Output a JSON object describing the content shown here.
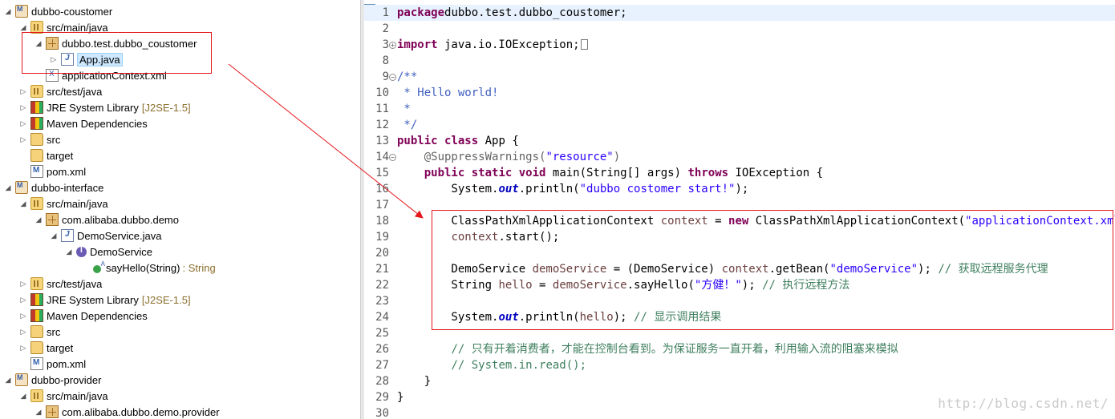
{
  "explorer": {
    "rows": [
      {
        "depth": 0,
        "twisty": "open",
        "icon": "maven-project-icon",
        "label": "dubbo-coustomer"
      },
      {
        "depth": 1,
        "twisty": "open",
        "icon": "source-folder-icon",
        "label": "src/main/java"
      },
      {
        "depth": 2,
        "twisty": "open",
        "icon": "package-icon",
        "label": "dubbo.test.dubbo_coustomer"
      },
      {
        "depth": 3,
        "twisty": "closed",
        "icon": "java-file-icon",
        "label": "App.java",
        "selected": true
      },
      {
        "depth": 2,
        "twisty": "none",
        "icon": "xml-file-icon",
        "label": "applicationContext.xml"
      },
      {
        "depth": 1,
        "twisty": "closed",
        "icon": "source-folder-icon",
        "label": "src/test/java"
      },
      {
        "depth": 1,
        "twisty": "closed",
        "icon": "library-icon",
        "label": "JRE System Library",
        "suffix": "[J2SE-1.5]"
      },
      {
        "depth": 1,
        "twisty": "closed",
        "icon": "library-icon",
        "label": "Maven Dependencies"
      },
      {
        "depth": 1,
        "twisty": "closed",
        "icon": "folder-icon",
        "label": "src"
      },
      {
        "depth": 1,
        "twisty": "none",
        "icon": "folder-icon",
        "label": "target"
      },
      {
        "depth": 1,
        "twisty": "none",
        "icon": "pom-file-icon",
        "label": "pom.xml"
      },
      {
        "depth": 0,
        "twisty": "open",
        "icon": "maven-project-icon",
        "label": "dubbo-interface"
      },
      {
        "depth": 1,
        "twisty": "open",
        "icon": "source-folder-icon",
        "label": "src/main/java"
      },
      {
        "depth": 2,
        "twisty": "open",
        "icon": "package-icon",
        "label": "com.alibaba.dubbo.demo"
      },
      {
        "depth": 3,
        "twisty": "open",
        "icon": "java-file-icon",
        "label": "DemoService.java"
      },
      {
        "depth": 4,
        "twisty": "open",
        "icon": "interface-icon",
        "label": "DemoService"
      },
      {
        "depth": 5,
        "twisty": "none",
        "icon": "method-icon",
        "label": "sayHello(String)",
        "type": ": String"
      },
      {
        "depth": 1,
        "twisty": "closed",
        "icon": "source-folder-icon",
        "label": "src/test/java"
      },
      {
        "depth": 1,
        "twisty": "closed",
        "icon": "library-icon",
        "label": "JRE System Library",
        "suffix": "[J2SE-1.5]"
      },
      {
        "depth": 1,
        "twisty": "closed",
        "icon": "library-icon",
        "label": "Maven Dependencies"
      },
      {
        "depth": 1,
        "twisty": "closed",
        "icon": "folder-icon",
        "label": "src"
      },
      {
        "depth": 1,
        "twisty": "closed",
        "icon": "folder-icon",
        "label": "target"
      },
      {
        "depth": 1,
        "twisty": "none",
        "icon": "pom-file-icon",
        "label": "pom.xml"
      },
      {
        "depth": 0,
        "twisty": "open",
        "icon": "maven-project-icon",
        "label": "dubbo-provider"
      },
      {
        "depth": 1,
        "twisty": "open",
        "icon": "source-folder-icon",
        "label": "src/main/java"
      },
      {
        "depth": 2,
        "twisty": "open",
        "icon": "package-icon",
        "label": "com.alibaba.dubbo.demo.provider"
      }
    ]
  },
  "editor": {
    "current_line": 1,
    "lines": [
      {
        "n": "1",
        "tokens": [
          [
            "kw",
            "package"
          ],
          [
            "",
            "dubbo.test.dubbo_coustomer;"
          ]
        ]
      },
      {
        "n": "2",
        "tokens": []
      },
      {
        "n": "3",
        "fold": "plus",
        "tokens": [
          [
            "kw",
            "import"
          ],
          [
            "",
            " java.io.IOException;"
          ],
          [
            "box",
            ""
          ]
        ]
      },
      {
        "n": "8",
        "tokens": []
      },
      {
        "n": "9",
        "fold": "minus",
        "tokens": [
          [
            "jd",
            "/**"
          ]
        ]
      },
      {
        "n": "10",
        "tokens": [
          [
            "jd",
            " * Hello world!"
          ]
        ]
      },
      {
        "n": "11",
        "tokens": [
          [
            "jd",
            " *"
          ]
        ]
      },
      {
        "n": "12",
        "tokens": [
          [
            "jd",
            " */"
          ]
        ]
      },
      {
        "n": "13",
        "tokens": [
          [
            "kw",
            "public"
          ],
          [
            "",
            " "
          ],
          [
            "kw",
            "class"
          ],
          [
            "",
            " App {"
          ]
        ]
      },
      {
        "n": "14",
        "fold": "minus",
        "tokens": [
          [
            "",
            "    "
          ],
          [
            "ann",
            "@SuppressWarnings("
          ],
          [
            "str",
            "\"resource\""
          ],
          [
            "ann",
            ")"
          ]
        ]
      },
      {
        "n": "15",
        "tokens": [
          [
            "",
            "    "
          ],
          [
            "kw",
            "public"
          ],
          [
            "",
            " "
          ],
          [
            "kw",
            "static"
          ],
          [
            "",
            " "
          ],
          [
            "kw",
            "void"
          ],
          [
            "",
            " main(String[] args) "
          ],
          [
            "kw",
            "throws"
          ],
          [
            "",
            " IOException {"
          ]
        ]
      },
      {
        "n": "16",
        "tokens": [
          [
            "",
            "        System."
          ],
          [
            "fld",
            "out"
          ],
          [
            "",
            ".println("
          ],
          [
            "str",
            "\"dubbo costomer start!\""
          ],
          [
            "",
            ");"
          ]
        ]
      },
      {
        "n": "17",
        "tokens": []
      },
      {
        "n": "18",
        "tokens": [
          [
            "",
            "        ClassPathXmlApplicationContext "
          ],
          [
            "lv",
            "context"
          ],
          [
            "",
            " = "
          ],
          [
            "kw",
            "new"
          ],
          [
            "",
            " ClassPathXmlApplicationContext("
          ],
          [
            "str",
            "\"applicationContext.xml\""
          ],
          [
            "",
            ");"
          ]
        ]
      },
      {
        "n": "19",
        "tokens": [
          [
            "",
            "        "
          ],
          [
            "lv",
            "context"
          ],
          [
            "",
            ".start();"
          ]
        ]
      },
      {
        "n": "20",
        "tokens": []
      },
      {
        "n": "21",
        "tokens": [
          [
            "",
            "        DemoService "
          ],
          [
            "lv",
            "demoService"
          ],
          [
            "",
            " = (DemoService) "
          ],
          [
            "lv",
            "context"
          ],
          [
            "",
            ".getBean("
          ],
          [
            "str",
            "\"demoService\""
          ],
          [
            "",
            "); "
          ],
          [
            "cm",
            "// 获取远程服务代理"
          ]
        ]
      },
      {
        "n": "22",
        "tokens": [
          [
            "",
            "        String "
          ],
          [
            "lv",
            "hello"
          ],
          [
            "",
            " = "
          ],
          [
            "lv",
            "demoService"
          ],
          [
            "",
            ".sayHello("
          ],
          [
            "str",
            "\"方健！\""
          ],
          [
            "",
            "); "
          ],
          [
            "cm",
            "// 执行远程方法"
          ]
        ]
      },
      {
        "n": "23",
        "tokens": []
      },
      {
        "n": "24",
        "tokens": [
          [
            "",
            "        System."
          ],
          [
            "fld",
            "out"
          ],
          [
            "",
            ".println("
          ],
          [
            "lv",
            "hello"
          ],
          [
            "",
            "); "
          ],
          [
            "cm",
            "// 显示调用结果"
          ]
        ]
      },
      {
        "n": "25",
        "tokens": []
      },
      {
        "n": "26",
        "tokens": [
          [
            "",
            "        "
          ],
          [
            "cm",
            "// 只有开着消费者，才能在控制台看到。为保证服务一直开着，利用输入流的阻塞来模拟"
          ]
        ]
      },
      {
        "n": "27",
        "tokens": [
          [
            "",
            "        "
          ],
          [
            "cm",
            "// System.in.read();"
          ]
        ]
      },
      {
        "n": "28",
        "tokens": [
          [
            "",
            "    }"
          ]
        ]
      },
      {
        "n": "29",
        "tokens": [
          [
            "",
            "}"
          ]
        ]
      },
      {
        "n": "30",
        "tokens": []
      }
    ]
  },
  "annotation": {
    "color": "#e3171c"
  },
  "watermark": "http://blog.csdn.net/"
}
